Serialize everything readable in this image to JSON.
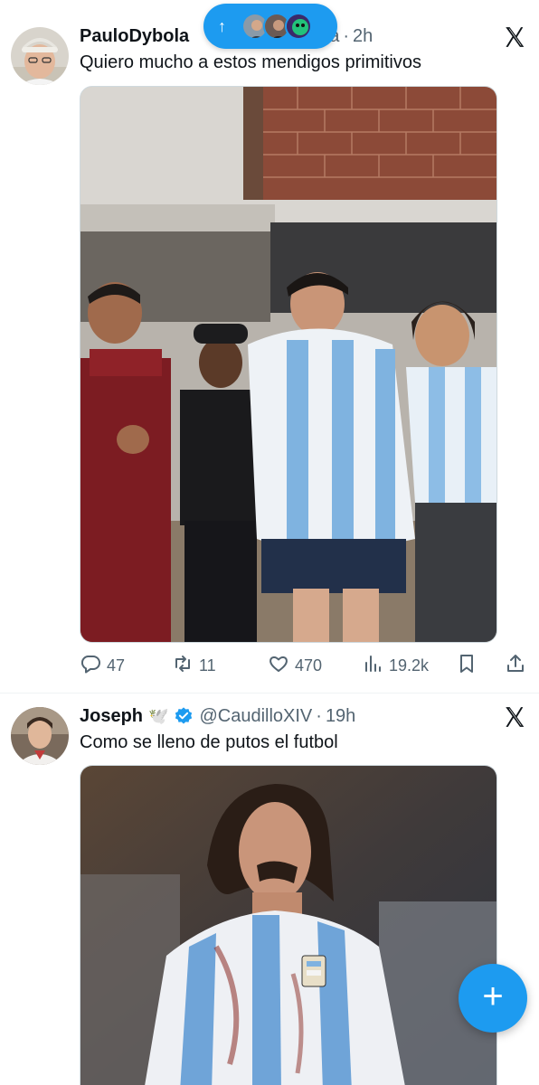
{
  "new_posts": {
    "arrow": "↑"
  },
  "tweets": [
    {
      "name": "PauloDybola",
      "handle_visible": "ira",
      "dot": "·",
      "time": "2h",
      "text": "Quiero mucho a estos mendigos primitivos",
      "replies": "47",
      "reposts": "11",
      "likes": "470",
      "views": "19.2k"
    },
    {
      "name": "Joseph",
      "emoji": "🕊️",
      "handle": "@CaudilloXIV",
      "dot": "·",
      "time": "19h",
      "text": "Como se lleno de putos el futbol"
    }
  ],
  "fab": {
    "label": "+"
  },
  "colors": {
    "accent": "#1d9bf0",
    "muted": "#536471",
    "text": "#0f1419"
  }
}
